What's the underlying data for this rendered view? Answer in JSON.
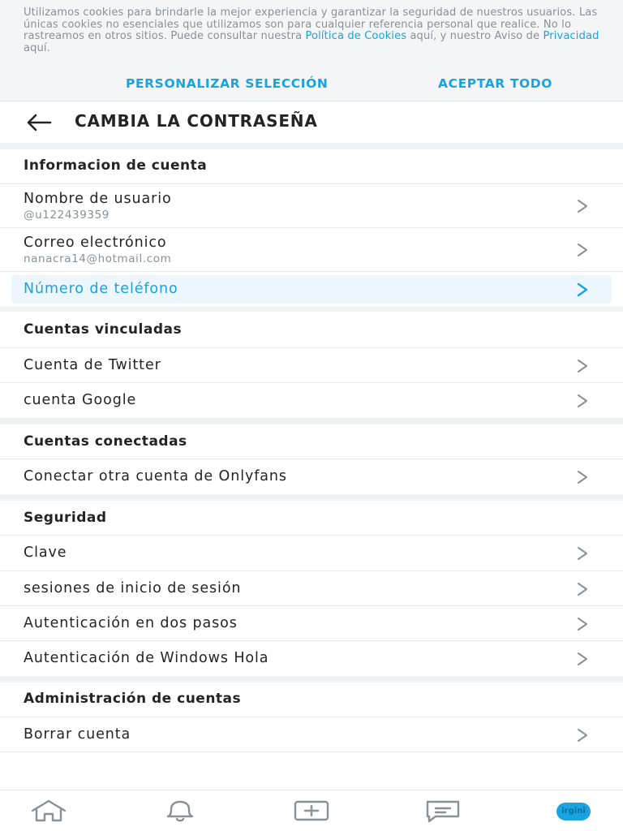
{
  "cookie_banner": {
    "text_before": "Utilizamos cookies para brindarle la mejor experiencia y garantizar la seguridad de nuestros usuarios. Las únicas cookies no esenciales que utilizamos son para cualquier referencia personal que realice. No lo rastreamos en otros sitios. Puede consultar nuestra",
    "cookie_policy_link": "Política de Cookies",
    "text_middle": "aquí, y nuestro Aviso de",
    "privacy_link": "Privacidad",
    "text_after": "aquí.",
    "customize_button": "PERSONALIZAR SELECCIÓN",
    "accept_button": "ACEPTAR TODO"
  },
  "header": {
    "title": "CAMBIA LA CONTRASEÑA",
    "back_icon": "arrow-left-icon"
  },
  "sections": {
    "account_info": {
      "title": "Informacion de cuenta",
      "username_label": "Nombre de usuario",
      "username_value": "@u122439359",
      "email_label": "Correo electrónico",
      "email_value": "nanacra14@hotmail.com",
      "phone_label": "Número de teléfono"
    },
    "linked": {
      "title": "Cuentas vinculadas",
      "twitter": "Cuenta de Twitter",
      "google": "cuenta Google"
    },
    "connected": {
      "title": "Cuentas conectadas",
      "connect_other": "Conectar otra cuenta de Onlyfans"
    },
    "security": {
      "title": "Seguridad",
      "password": "Clave",
      "sessions": "sesiones de inicio de sesión",
      "two_step": "Autenticación en dos pasos",
      "windows_hello": "Autenticación de Windows Hola"
    },
    "account_admin": {
      "title": "Administración de cuentas",
      "delete": "Borrar cuenta"
    }
  },
  "bottom_nav": {
    "items": [
      "home-icon",
      "bell-icon",
      "plus-square-icon",
      "message-icon"
    ],
    "avatar_text": "irgini"
  },
  "colors": {
    "accent": "#1aa3e0",
    "text": "#242424",
    "muted": "#8a9096",
    "divider": "#f0f1f3"
  }
}
